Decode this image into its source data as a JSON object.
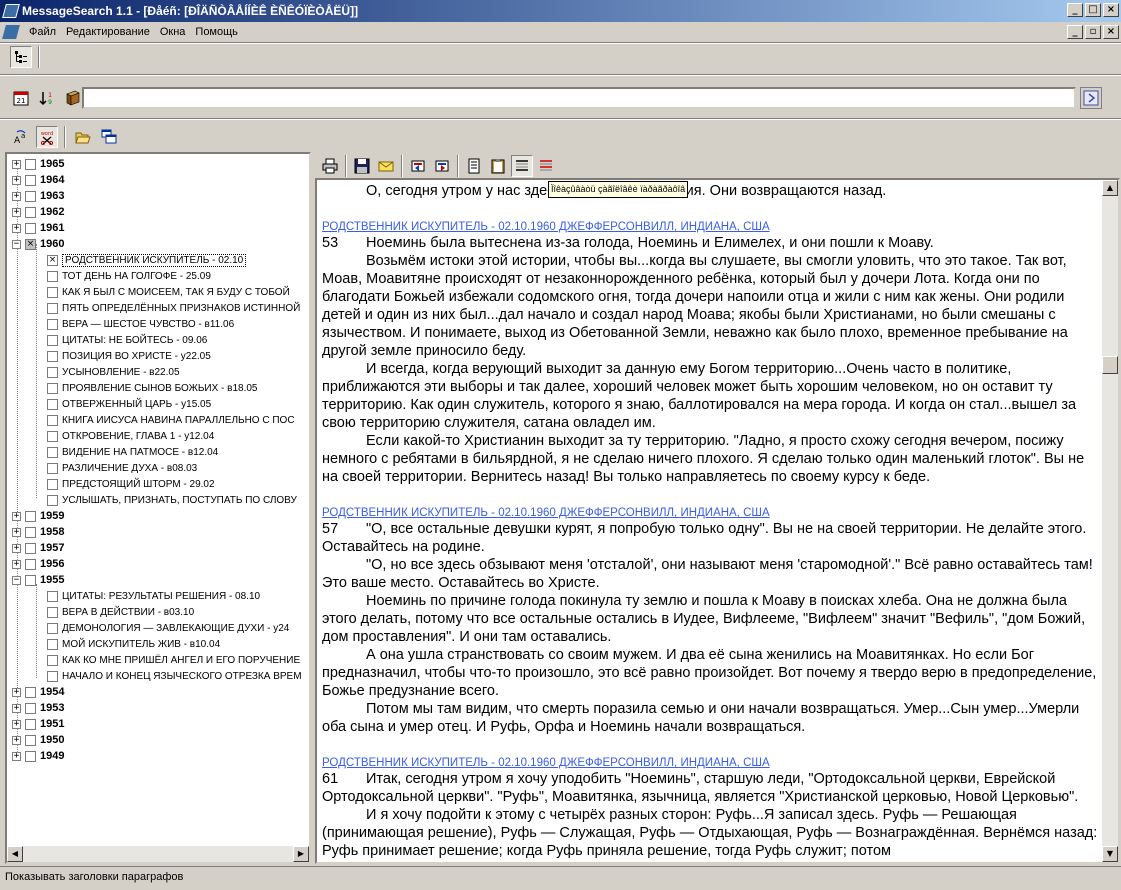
{
  "window": {
    "title": "MessageSearch 1.1 - [Ðåéñ: [ÐÎÄÑÒÂÅÍÍÈÊ ÈÑÊÓÏÈÒÅËÜ]]",
    "minimize": "_",
    "maximize": "□",
    "close": "×"
  },
  "menu": {
    "items": [
      {
        "label": "Файл"
      },
      {
        "label": "Редактирование"
      },
      {
        "label": "Окна"
      },
      {
        "label": "Помощь"
      }
    ],
    "mdi_minimize": "_",
    "mdi_restore": "▫",
    "mdi_close": "×"
  },
  "search": {
    "value": ""
  },
  "icons": {
    "tree_view": "tree-icon",
    "calendar": "calendar-icon",
    "sort": "sort-icon",
    "book": "book-icon",
    "search_go": "arrow-right-icon",
    "replace": "replace-icon",
    "word": "word-icon",
    "folder": "open-folder-icon",
    "windows": "windows-icon",
    "print": "printer-icon",
    "save": "save-icon",
    "mail": "mail-icon"
  },
  "word_icon_text": "word",
  "tooltip": "Ïîêàçûâàòü çàãîëîâêè ïàðàãðàôîâ",
  "tree": {
    "years_top": [
      {
        "label": "1965"
      },
      {
        "label": "1964"
      },
      {
        "label": "1963"
      },
      {
        "label": "1962"
      },
      {
        "label": "1961"
      }
    ],
    "year_1960": {
      "label": "1960",
      "items": [
        {
          "label": "РОДСТВЕННИК ИСКУПИТЕЛЬ -  02.10",
          "selected": true
        },
        {
          "label": "ТОТ ДЕНЬ НА ГОЛГОФЕ -  25.09"
        },
        {
          "label": "КАК Я БЫЛ С МОИСЕЕМ, ТАК Я БУДУ С ТОБОЙ"
        },
        {
          "label": "ПЯТЬ ОПРЕДЕЛЁННЫХ ПРИЗНАКОВ ИСТИННОЙ"
        },
        {
          "label": "ВЕРА — ШЕСТОЕ ЧУВСТВО - в11.06"
        },
        {
          "label": "ЦИТАТЫ: НЕ БОЙТЕСЬ -  09.06"
        },
        {
          "label": "ПОЗИЦИЯ ВО ХРИСТЕ - у22.05"
        },
        {
          "label": "УСЫНОВЛЕНИЕ - в22.05"
        },
        {
          "label": "ПРОЯВЛЕНИЕ СЫНОВ БОЖЬИХ - в18.05"
        },
        {
          "label": "ОТВЕРЖЕННЫЙ ЦАРЬ - у15.05"
        },
        {
          "label": "КНИГА ИИСУСА НАВИНА ПАРАЛЛЕЛЬНО С ПОС"
        },
        {
          "label": "ОТКРОВЕНИЕ, ГЛАВА 1 - у12.04"
        },
        {
          "label": "ВИДЕНИЕ НА ПАТМОСЕ - в12.04"
        },
        {
          "label": "РАЗЛИЧЕНИЕ ДУХА - в08.03"
        },
        {
          "label": "ПРЕДСТОЯЩИЙ ШТОРМ -  29.02"
        },
        {
          "label": "УСЛЫШАТЬ, ПРИЗНАТЬ, ПОСТУПАТЬ ПО СЛОВУ"
        }
      ]
    },
    "years_mid": [
      {
        "label": "1959"
      },
      {
        "label": "1958"
      },
      {
        "label": "1957"
      },
      {
        "label": "1956"
      }
    ],
    "year_1955": {
      "label": "1955",
      "items": [
        {
          "label": "ЦИТАТЫ: РЕЗУЛЬТАТЫ РЕШЕНИЯ -  08.10"
        },
        {
          "label": "ВЕРА В ДЕЙСТВИИ - в03.10"
        },
        {
          "label": "ДЕМОНОЛОГИЯ — ЗАВЛЕКАЮЩИЕ ДУХИ - у24"
        },
        {
          "label": "МОЙ ИСКУПИТЕЛЬ ЖИВ - в10.04"
        },
        {
          "label": "КАК КО МНЕ ПРИШЁЛ АНГЕЛ И ЕГО ПОРУЧЕНИЕ"
        },
        {
          "label": "НАЧАЛО И КОНЕЦ ЯЗЫЧЕСКОГО ОТРЕЗКА ВРЕМ"
        }
      ]
    },
    "years_bottom": [
      {
        "label": "1954"
      },
      {
        "label": "1953"
      },
      {
        "label": "1951"
      },
      {
        "label": "1950"
      },
      {
        "label": "1949"
      }
    ]
  },
  "reader": {
    "first_line": "О, сегодня утром у нас здесь прекрасная история. Они возвращаются назад.",
    "sections": [
      {
        "ref": "РОДСТВЕННИК ИСКУПИТЕЛЬ -  02.10.1960 ДЖЕФФЕРСОНВИЛЛ, ИНДИАНА, США",
        "num": "53",
        "first": "Ноеминь была вытеснена из-за голода, Ноеминь и Елимелех, и они пошли к Моаву.",
        "paras": [
          "Возьмём истоки этой истории, чтобы вы...когда вы слушаете, вы смогли уловить, что это такое. Так вот, Моав, Моавитяне происходят от незаконнорожденного ребёнка, который был у дочери Лота. Когда они по благодати Божьей избежали содомского огня, тогда дочери напоили отца и жили с ним как жены. Они родили детей и один из них был...дал начало и создал народ Моава; якобы были Христианами, но были смешаны с язычеством. И понимаете, выход из Обетованной Земли, неважно как было плохо, временное пребывание на другой земле приносило беду.",
          "И всегда, когда верующий выходит за данную ему Богом территорию...Очень часто в политике, приближаются эти выборы и так далее, хороший человек может быть хорошим человеком, но он оставит ту территорию. Как один служитель, которого я знаю, баллотировался на мера города. И когда он стал...вышел за свою территорию служителя, сатана овладел им.",
          "Если какой-то Христианин выходит за ту территорию. \"Ладно, я просто схожу сегодня вечером, посижу немного с ребятами в бильярдной, я не сделаю ничего плохого. Я сделаю только один маленький глоток\". Вы не на своей территории. Вернитесь назад! Вы только направляетесь по своему курсу к беде."
        ]
      },
      {
        "ref": "РОДСТВЕННИК ИСКУПИТЕЛЬ -  02.10.1960 ДЖЕФФЕРСОНВИЛЛ, ИНДИАНА, США",
        "num": "57",
        "first": "\"О, все остальные девушки курят, я попробую только одну\". Вы не на своей территории. Не делайте этого. Оставайтесь на родине.",
        "paras": [
          "\"О, но все здесь обзывают меня 'отсталой', они называют меня 'старомодной'.\" Всё равно оставайтесь там! Это ваше место. Оставайтесь во Христе.",
          "Ноеминь по причине голода покинула ту землю и пошла к Моаву в поисках хлеба. Она не должна была этого делать, потому что все остальные остались в Иудее, Вифлееме, \"Вифлеем\" значит \"Вефиль\", \"дом Божий, дом проставления\". И они там оставались.",
          "А она ушла странствовать со своим мужем. И два её сына женились на Моавитянках. Но если Бог предназначил, чтобы что-то произошло, это всё равно произойдет. Вот почему я твердо верю в предопределение, Божье предузнание всего.",
          "Потом мы там видим, что смерть поразила семью и они начали возвращаться. Умер...Сын умер...Умерли оба сына и умер отец. И Руфь, Орфа и Ноеминь начали возвращаться."
        ]
      },
      {
        "ref": "РОДСТВЕННИК ИСКУПИТЕЛЬ -  02.10.1960 ДЖЕФФЕРСОНВИЛЛ, ИНДИАНА, США",
        "num": "61",
        "first": "Итак, сегодня утром я хочу уподобить \"Ноеминь\", старшую леди, \"Ортодоксальной церкви, Еврейской Ортодоксальной церкви\". \"Руфь\", Моавитянка, язычница, является \"Христианской церковью, Новой Церковью\".",
        "paras": [
          "И я хочу подойти к этому с четырёх разных сторон: Руфь...Я записал здесь. Руфь — Решающая (принимающая решение), Руфь — Служащая, Руфь — Отдыхающая, Руфь — Вознаграждённая. Вернёмся назад: Руфь принимает решение; когда Руфь приняла решение, тогда Руфь служит; потом"
        ]
      }
    ]
  },
  "status": {
    "text": "Показывать заголовки параграфов"
  }
}
